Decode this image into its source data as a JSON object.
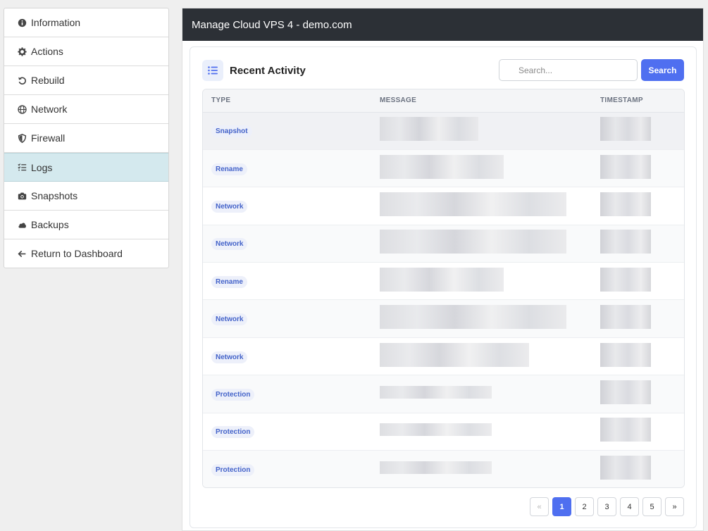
{
  "sidebar": {
    "items": [
      {
        "label": "Information",
        "icon": "info-icon"
      },
      {
        "label": "Actions",
        "icon": "gear-icon"
      },
      {
        "label": "Rebuild",
        "icon": "rotate-icon"
      },
      {
        "label": "Network",
        "icon": "globe-icon"
      },
      {
        "label": "Firewall",
        "icon": "shield-icon"
      },
      {
        "label": "Logs",
        "icon": "list-icon",
        "active": true
      },
      {
        "label": "Snapshots",
        "icon": "camera-icon"
      },
      {
        "label": "Backups",
        "icon": "cloud-icon"
      },
      {
        "label": "Return to Dashboard",
        "icon": "arrow-left-icon"
      }
    ]
  },
  "header": {
    "title": "Manage Cloud VPS 4 - demo.com"
  },
  "activity": {
    "title": "Recent Activity",
    "search_placeholder": "Search...",
    "search_button": "Search",
    "columns": [
      "TYPE",
      "MESSAGE",
      "TIMESTAMP"
    ],
    "rows": [
      {
        "type": "Snapshot"
      },
      {
        "type": "Rename"
      },
      {
        "type": "Network"
      },
      {
        "type": "Network"
      },
      {
        "type": "Rename"
      },
      {
        "type": "Network"
      },
      {
        "type": "Network"
      },
      {
        "type": "Protection"
      },
      {
        "type": "Protection"
      },
      {
        "type": "Protection"
      }
    ]
  },
  "pagination": {
    "prev": "«",
    "pages": [
      "1",
      "2",
      "3",
      "4",
      "5"
    ],
    "current": "1",
    "next": "»"
  },
  "colors": {
    "accent": "#4f6ff0",
    "header_bg": "#2c3036",
    "active_bg": "#d4e9ee"
  }
}
